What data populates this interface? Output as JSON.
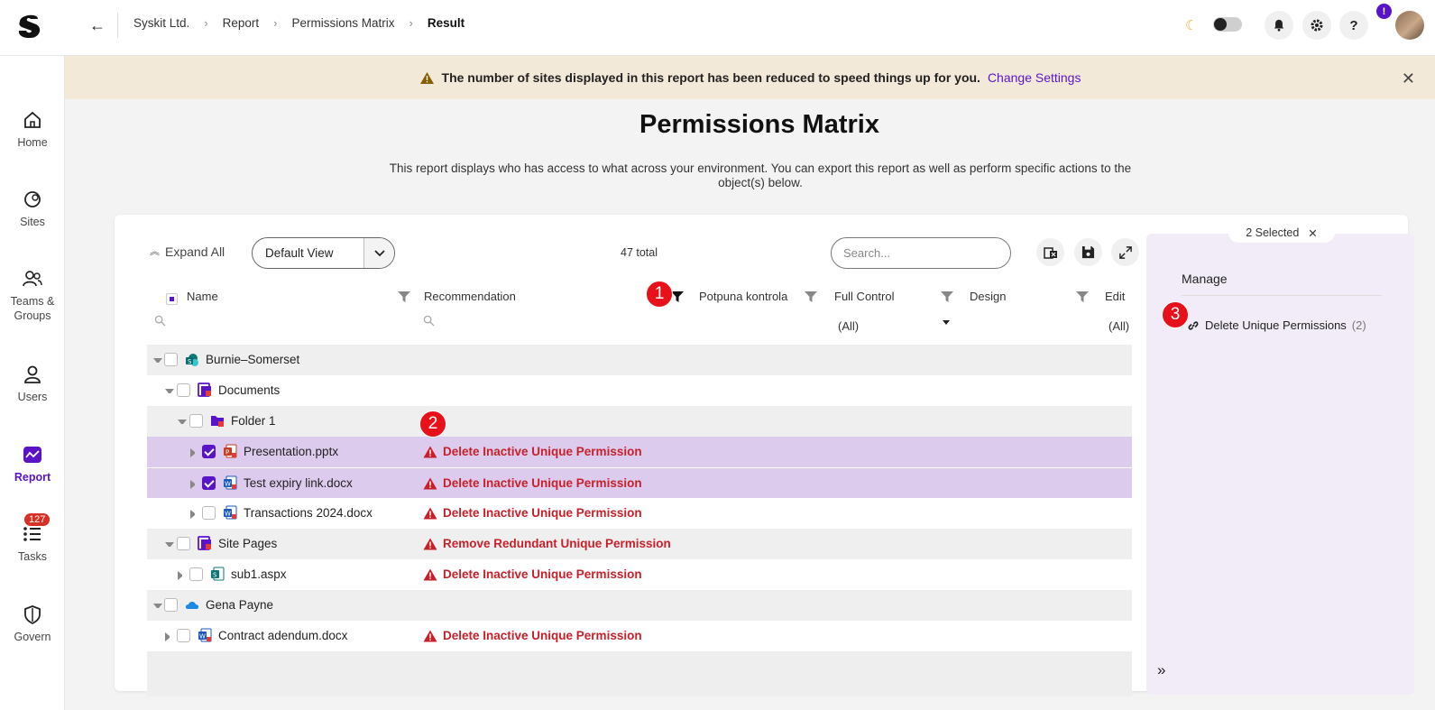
{
  "breadcrumbs": [
    "Syskit Ltd.",
    "Report",
    "Permissions Matrix",
    "Result"
  ],
  "help_badge": "!",
  "nav": [
    {
      "label": "Home"
    },
    {
      "label": "Sites"
    },
    {
      "label": "Teams & Groups"
    },
    {
      "label": "Users"
    },
    {
      "label": "Report"
    },
    {
      "label": "Tasks",
      "badge": "127"
    },
    {
      "label": "Govern"
    }
  ],
  "banner": {
    "message": "The number of sites displayed in this report has been reduced to speed things up for you.",
    "link": "Change Settings"
  },
  "page": {
    "title": "Permissions Matrix",
    "description": "This report displays who has access to what across your environment. You can export this report as well as perform specific actions to the object(s) below."
  },
  "toolbar": {
    "expand_all": "Expand All",
    "view": "Default View",
    "total": "47 total",
    "search_placeholder": "Search..."
  },
  "columns": {
    "name": "Name",
    "recommendation": "Recommendation",
    "col1": "Potpuna kontrola",
    "col2": "Full Control",
    "col3": "Design",
    "col4": "Edit",
    "filter_all_1": "(All)",
    "filter_all_2": "(All)"
  },
  "markers": [
    "1",
    "2",
    "3"
  ],
  "rows": [
    {
      "name": "Burnie–Somerset",
      "recommendation": ""
    },
    {
      "name": "Documents",
      "recommendation": ""
    },
    {
      "name": "Folder 1",
      "recommendation": ""
    },
    {
      "name": "Presentation.pptx",
      "recommendation": "Delete Inactive Unique Permission"
    },
    {
      "name": "Test expiry link.docx",
      "recommendation": "Delete Inactive Unique Permission"
    },
    {
      "name": "Transactions 2024.docx",
      "recommendation": "Delete Inactive Unique Permission"
    },
    {
      "name": "Site Pages",
      "recommendation": "Remove Redundant Unique Permission"
    },
    {
      "name": "sub1.aspx",
      "recommendation": "Delete Inactive Unique Permission"
    },
    {
      "name": "Gena Payne",
      "recommendation": ""
    },
    {
      "name": "Contract adendum.docx",
      "recommendation": "Delete Inactive Unique Permission"
    }
  ],
  "panel": {
    "selected": "2 Selected",
    "manage": "Manage",
    "action": "Delete Unique Permissions",
    "action_count": "(2)"
  },
  "colors": {
    "accent": "#5a14c8",
    "warning": "#c6202a",
    "selected_row": "#dccbed",
    "banner": "#f3e9d8"
  }
}
